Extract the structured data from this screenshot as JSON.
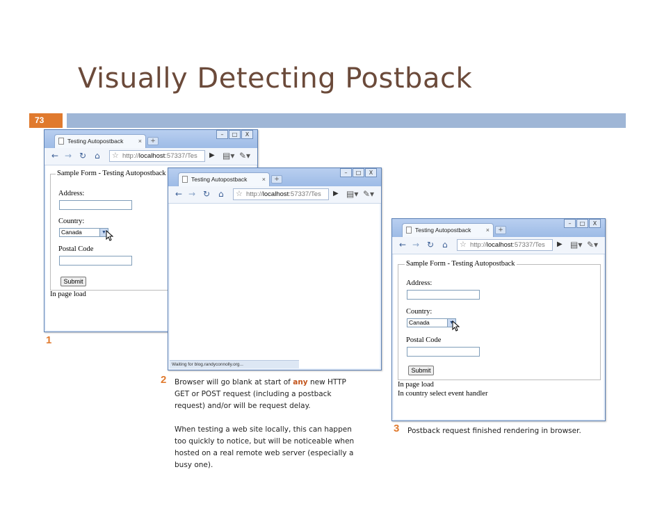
{
  "slide": {
    "title": "Visually Detecting Postback",
    "number": "73"
  },
  "browser": {
    "tab_title": "Testing Autopostback",
    "tab_close": "×",
    "new_tab": "+",
    "url_prefix": "http://",
    "url_host": "localhost",
    "url_suffix": ":57337/Tes",
    "controls": [
      "–",
      "□",
      "X"
    ]
  },
  "form": {
    "legend": "Sample Form - Testing Autopostback",
    "address_label": "Address:",
    "country_label": "Country:",
    "country_value": "Canada",
    "postal_label": "Postal Code",
    "submit_label": "Submit"
  },
  "window1": {
    "log": [
      "In page load"
    ],
    "step_number": "1"
  },
  "window2": {
    "status_text": "Waiting for blog.randyconnolly.org...",
    "step_number": "2",
    "caption_line1_pre": "Browser will go blank at start of ",
    "caption_line1_em": "any",
    "caption_line1_post": " new HTTP",
    "caption_lines": [
      "GET or POST request (including a postback",
      "request) and/or will be request delay."
    ],
    "caption2_lines": [
      "When testing a web site locally, this can happen",
      "too quickly to notice, but will be noticeable when",
      "hosted on a real remote web server (especially a",
      "busy one)."
    ]
  },
  "window3": {
    "log": [
      "In page load",
      "In country select event handler"
    ],
    "step_number": "3",
    "caption": "Postback request finished rendering in browser."
  },
  "colors": {
    "title": "#6b4a3a",
    "accent": "#e07a2e",
    "bar": "#9fb6d6"
  }
}
